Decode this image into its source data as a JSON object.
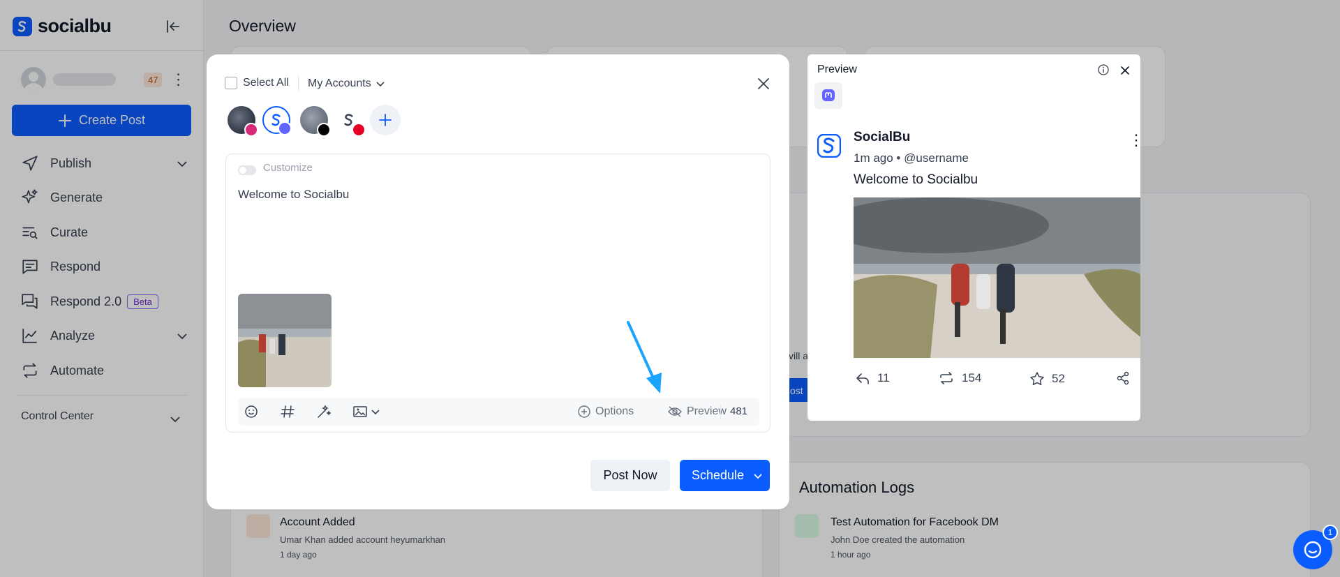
{
  "app": {
    "name": "socialbu",
    "brand_color": "#0b5cff"
  },
  "sidebar": {
    "notification_count": "47",
    "create_post_label": "Create Post",
    "items": [
      {
        "label": "Publish",
        "icon": "send-icon",
        "expandable": true
      },
      {
        "label": "Generate",
        "icon": "sparkles-icon",
        "expandable": false
      },
      {
        "label": "Curate",
        "icon": "search-list-icon",
        "expandable": false
      },
      {
        "label": "Respond",
        "icon": "message-icon",
        "expandable": false
      },
      {
        "label": "Respond 2.0",
        "icon": "messages-icon",
        "expandable": false,
        "badge": "Beta"
      },
      {
        "label": "Analyze",
        "icon": "chart-line-icon",
        "expandable": true
      },
      {
        "label": "Automate",
        "icon": "repeat-icon",
        "expandable": false
      }
    ],
    "control_center": "Control Center"
  },
  "main": {
    "title": "Overview",
    "activity_logs": [
      {
        "title": "Account Added",
        "subtitle": "Umar Khan added account heyumarkhan",
        "time": "1 day ago"
      }
    ],
    "automation_logs": {
      "title": "Automation Logs",
      "items": [
        {
          "title": "Test Automation for Facebook DM",
          "subtitle": "John Doe created the automation",
          "time": "1 hour ago"
        }
      ]
    },
    "partial_text": "vill a",
    "partial_button": "ost"
  },
  "composer": {
    "select_all": "Select All",
    "accounts_dropdown": "My Accounts",
    "accounts": [
      {
        "network": "instagram",
        "network_color": "#d62976"
      },
      {
        "network": "mastodon",
        "network_color": "#6364ff",
        "selected": true
      },
      {
        "network": "threads",
        "network_color": "#000000"
      },
      {
        "network": "pinterest",
        "network_color": "#e60023"
      }
    ],
    "customize_label": "Customize",
    "post_text": "Welcome to Socialbu",
    "toolbar": {
      "options_label": "Options",
      "preview_label": "Preview",
      "char_count": "481"
    },
    "post_now_label": "Post Now",
    "schedule_label": "Schedule"
  },
  "preview": {
    "title": "Preview",
    "network_tab": "mastodon-icon",
    "account_name": "SocialBu",
    "meta": "1m ago • @username",
    "text": "Welcome to Socialbu",
    "actions": {
      "replies": "11",
      "boosts": "154",
      "favourites": "52"
    }
  },
  "chat": {
    "unread": "1"
  }
}
